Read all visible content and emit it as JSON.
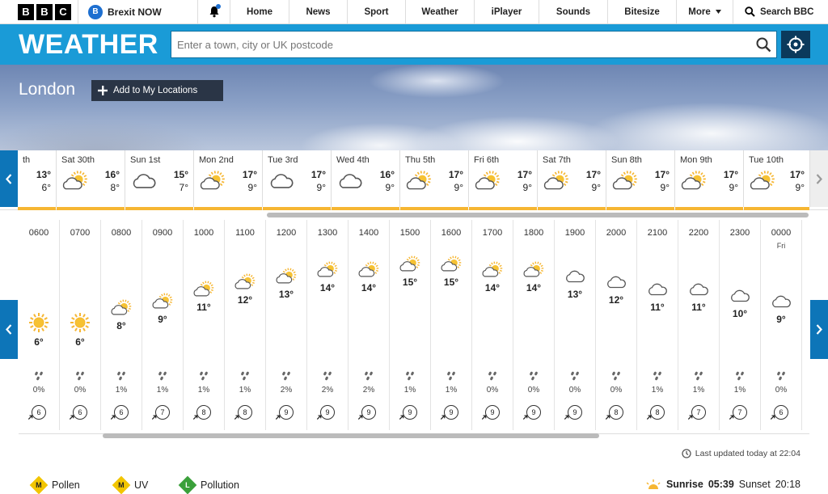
{
  "nav": {
    "logo": [
      "B",
      "B",
      "C"
    ],
    "brexit_badge": "B",
    "brexit_label": "Brexit NOW",
    "links": [
      "Home",
      "News",
      "Sport",
      "Weather",
      "iPlayer",
      "Sounds",
      "Bitesize",
      "More"
    ],
    "search_label": "Search BBC"
  },
  "weather": {
    "title": "WEATHER",
    "search_placeholder": "Enter a town, city or UK postcode"
  },
  "location": {
    "city": "London",
    "add_label": "Add to My Locations"
  },
  "days": [
    {
      "name": "th",
      "hi": "13°",
      "lo": "6°",
      "icon": "sun-cloud"
    },
    {
      "name": "Sat 30th",
      "hi": "16°",
      "lo": "8°",
      "icon": "sun-cloud"
    },
    {
      "name": "Sun 1st",
      "hi": "15°",
      "lo": "7°",
      "icon": "cloud"
    },
    {
      "name": "Mon 2nd",
      "hi": "17°",
      "lo": "9°",
      "icon": "sun-cloud"
    },
    {
      "name": "Tue 3rd",
      "hi": "17°",
      "lo": "9°",
      "icon": "cloud"
    },
    {
      "name": "Wed 4th",
      "hi": "16°",
      "lo": "9°",
      "icon": "cloud"
    },
    {
      "name": "Thu 5th",
      "hi": "17°",
      "lo": "9°",
      "icon": "sun-cloud"
    },
    {
      "name": "Fri 6th",
      "hi": "17°",
      "lo": "9°",
      "icon": "sun-cloud"
    },
    {
      "name": "Sat 7th",
      "hi": "17°",
      "lo": "9°",
      "icon": "sun-cloud"
    },
    {
      "name": "Sun 8th",
      "hi": "17°",
      "lo": "9°",
      "icon": "sun-cloud"
    },
    {
      "name": "Mon 9th",
      "hi": "17°",
      "lo": "9°",
      "icon": "sun-cloud"
    },
    {
      "name": "Tue 10th",
      "hi": "17°",
      "lo": "9°",
      "icon": "sun-cloud"
    }
  ],
  "hours": [
    {
      "time": "0600",
      "temp": "6°",
      "icon": "sun",
      "rain": "0%",
      "wind": "6",
      "level": 0.25
    },
    {
      "time": "0700",
      "temp": "6°",
      "icon": "sun",
      "rain": "0%",
      "wind": "6",
      "level": 0.25
    },
    {
      "time": "0800",
      "temp": "8°",
      "icon": "sun-cloud",
      "rain": "1%",
      "wind": "6",
      "level": 0.38
    },
    {
      "time": "0900",
      "temp": "9°",
      "icon": "sun-cloud",
      "rain": "1%",
      "wind": "7",
      "level": 0.44
    },
    {
      "time": "1000",
      "temp": "11°",
      "icon": "sun-cloud",
      "rain": "1%",
      "wind": "8",
      "level": 0.56
    },
    {
      "time": "1100",
      "temp": "12°",
      "icon": "sun-cloud",
      "rain": "1%",
      "wind": "8",
      "level": 0.63
    },
    {
      "time": "1200",
      "temp": "13°",
      "icon": "sun-cloud",
      "rain": "2%",
      "wind": "9",
      "level": 0.69
    },
    {
      "time": "1300",
      "temp": "14°",
      "icon": "sun-cloud",
      "rain": "2%",
      "wind": "9",
      "level": 0.75
    },
    {
      "time": "1400",
      "temp": "14°",
      "icon": "sun-cloud",
      "rain": "2%",
      "wind": "9",
      "level": 0.75
    },
    {
      "time": "1500",
      "temp": "15°",
      "icon": "sun-cloud",
      "rain": "1%",
      "wind": "9",
      "level": 0.81
    },
    {
      "time": "1600",
      "temp": "15°",
      "icon": "sun-cloud",
      "rain": "1%",
      "wind": "9",
      "level": 0.81
    },
    {
      "time": "1700",
      "temp": "14°",
      "icon": "sun-cloud",
      "rain": "0%",
      "wind": "9",
      "level": 0.75
    },
    {
      "time": "1800",
      "temp": "14°",
      "icon": "sun-cloud",
      "rain": "0%",
      "wind": "9",
      "level": 0.75
    },
    {
      "time": "1900",
      "temp": "13°",
      "icon": "cloud",
      "rain": "0%",
      "wind": "9",
      "level": 0.69
    },
    {
      "time": "2000",
      "temp": "12°",
      "icon": "cloud",
      "rain": "0%",
      "wind": "8",
      "level": 0.63
    },
    {
      "time": "2100",
      "temp": "11°",
      "icon": "cloud",
      "rain": "1%",
      "wind": "8",
      "level": 0.56
    },
    {
      "time": "2200",
      "temp": "11°",
      "icon": "cloud",
      "rain": "1%",
      "wind": "7",
      "level": 0.56
    },
    {
      "time": "2300",
      "temp": "10°",
      "icon": "cloud",
      "rain": "1%",
      "wind": "7",
      "level": 0.5
    },
    {
      "time": "0000",
      "day": "Fri",
      "temp": "9°",
      "icon": "cloud",
      "rain": "0%",
      "wind": "6",
      "level": 0.44
    }
  ],
  "updated": "Last updated today at 22:04",
  "bottom": {
    "pollen": {
      "badge": "M",
      "label": "Pollen",
      "color": "#f2c500"
    },
    "uv": {
      "badge": "M",
      "label": "UV",
      "color": "#f2c500"
    },
    "pollution": {
      "badge": "L",
      "label": "Pollution",
      "color": "#3aa03a"
    },
    "sunrise_label": "Sunrise",
    "sunrise": "05:39",
    "sunset_label": "Sunset",
    "sunset": "20:18"
  },
  "colors": {
    "brand_blue": "#1a9bd7",
    "arrow_blue": "#0d75b8",
    "warm_bar": "#f6b632"
  }
}
